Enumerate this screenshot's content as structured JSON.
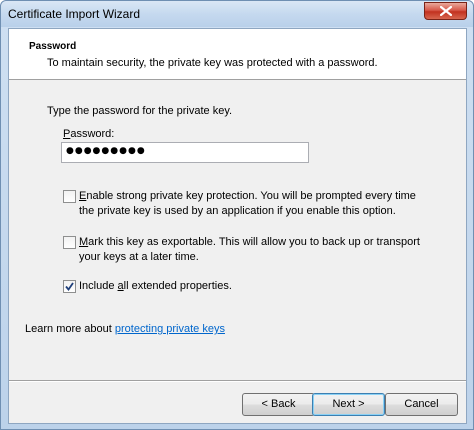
{
  "window": {
    "title": "Certificate Import Wizard"
  },
  "header": {
    "title": "Password",
    "description": "To maintain security, the private key was protected with a password."
  },
  "body": {
    "prompt": "Type the password for the private key.",
    "password_label_prefix": "",
    "password_label_accel": "P",
    "password_label_rest": "assword:",
    "password_value": "●●●●●●●●●"
  },
  "options": [
    {
      "accel": "E",
      "rest": "nable strong private key protection. You will be prompted every time the private key is used by an application if you enable this option.",
      "checked": false
    },
    {
      "accel": "M",
      "rest": "ark this key as exportable. This will allow you to back up or transport your keys at a later time.",
      "checked": false
    },
    {
      "pre": "Include ",
      "accel": "a",
      "rest": "ll extended properties.",
      "checked": true
    }
  ],
  "learn_more": {
    "text": "Learn more about ",
    "link": "protecting private keys"
  },
  "buttons": {
    "back": "< Back",
    "next": "Next >",
    "cancel": "Cancel"
  }
}
